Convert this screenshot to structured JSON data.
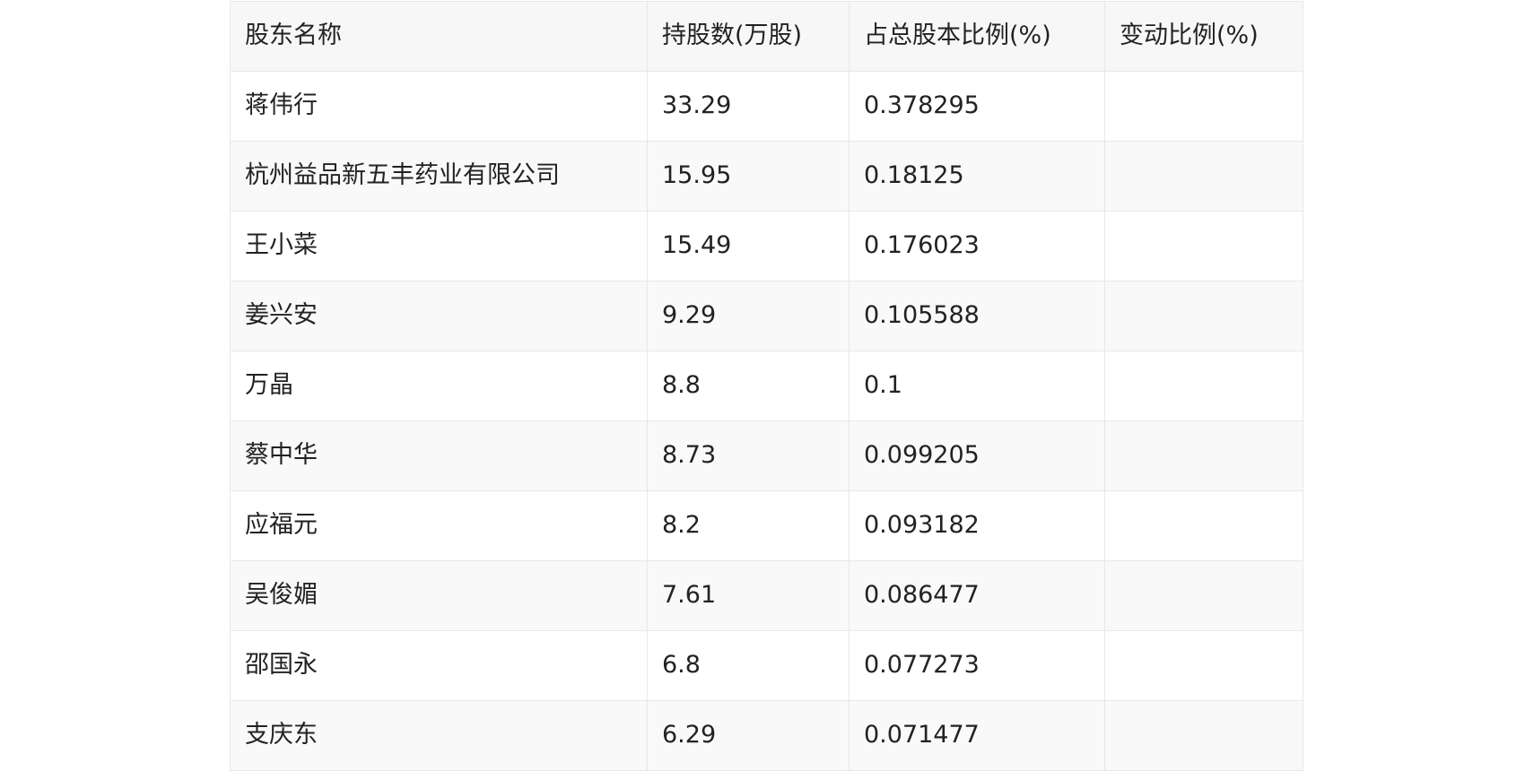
{
  "table": {
    "headers": [
      "股东名称",
      "持股数(万股)",
      "占总股本比例(%)",
      "变动比例(%)"
    ],
    "rows": [
      [
        "蒋伟行",
        "33.29",
        "0.378295",
        ""
      ],
      [
        "杭州益品新五丰药业有限公司",
        "15.95",
        "0.18125",
        ""
      ],
      [
        "王小菜",
        "15.49",
        "0.176023",
        ""
      ],
      [
        "姜兴安",
        "9.29",
        "0.105588",
        ""
      ],
      [
        "万晶",
        "8.8",
        "0.1",
        ""
      ],
      [
        "蔡中华",
        "8.73",
        "0.099205",
        ""
      ],
      [
        "应福元",
        "8.2",
        "0.093182",
        ""
      ],
      [
        "吴俊媚",
        "7.61",
        "0.086477",
        ""
      ],
      [
        "邵国永",
        "6.8",
        "0.077273",
        ""
      ],
      [
        "支庆东",
        "6.29",
        "0.071477",
        ""
      ]
    ]
  }
}
